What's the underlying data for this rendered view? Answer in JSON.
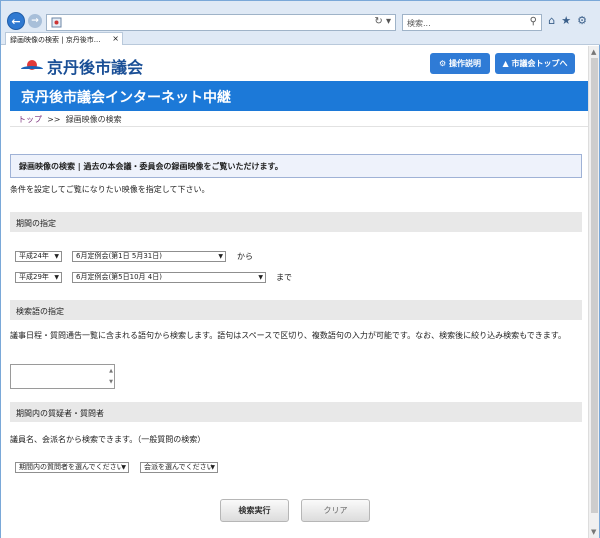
{
  "browser": {
    "search_placeholder": "検索...",
    "tab_title": "録画映像の検索 | 京丹後市..."
  },
  "header": {
    "logo_text": "京丹後市議会",
    "btn_guide": "⚙ 操作説明",
    "btn_top": "▲ 市議会トップへ",
    "banner": "京丹後市議会インターネット中継"
  },
  "breadcrumb": {
    "top": "トップ",
    "sep": ">>",
    "current": "録画映像の検索"
  },
  "notice": "録画映像の検索 | 過去の本会議・委員会の録画映像をご覧いただけます。",
  "intro": "条件を設定してご覧になりたい映像を指定して下さい。",
  "period": {
    "heading": "期間の指定",
    "from_year": "平成24年",
    "from_session": "6月定例会(第1日 5月31日)",
    "from_label": "から",
    "to_year": "平成29年",
    "to_session": "6月定例会(第5日10月 4日)",
    "to_label": "まで"
  },
  "keyword": {
    "heading": "検索語の指定",
    "description": "議事日程・質問通告一覧に含まれる語句から検索します。語句はスペースで区切り、複数語句の入力が可能です。なお、検索後に絞り込み検索もできます。",
    "value": ""
  },
  "speaker": {
    "heading": "期間内の質疑者・質問者",
    "description": "議員名、会派名から検索できます。（一般質問の検索）",
    "member_select": "期間内の質問者を選んでください",
    "faction_select": "会派を選んでください"
  },
  "buttons": {
    "search": "検索実行",
    "clear": "クリア"
  }
}
